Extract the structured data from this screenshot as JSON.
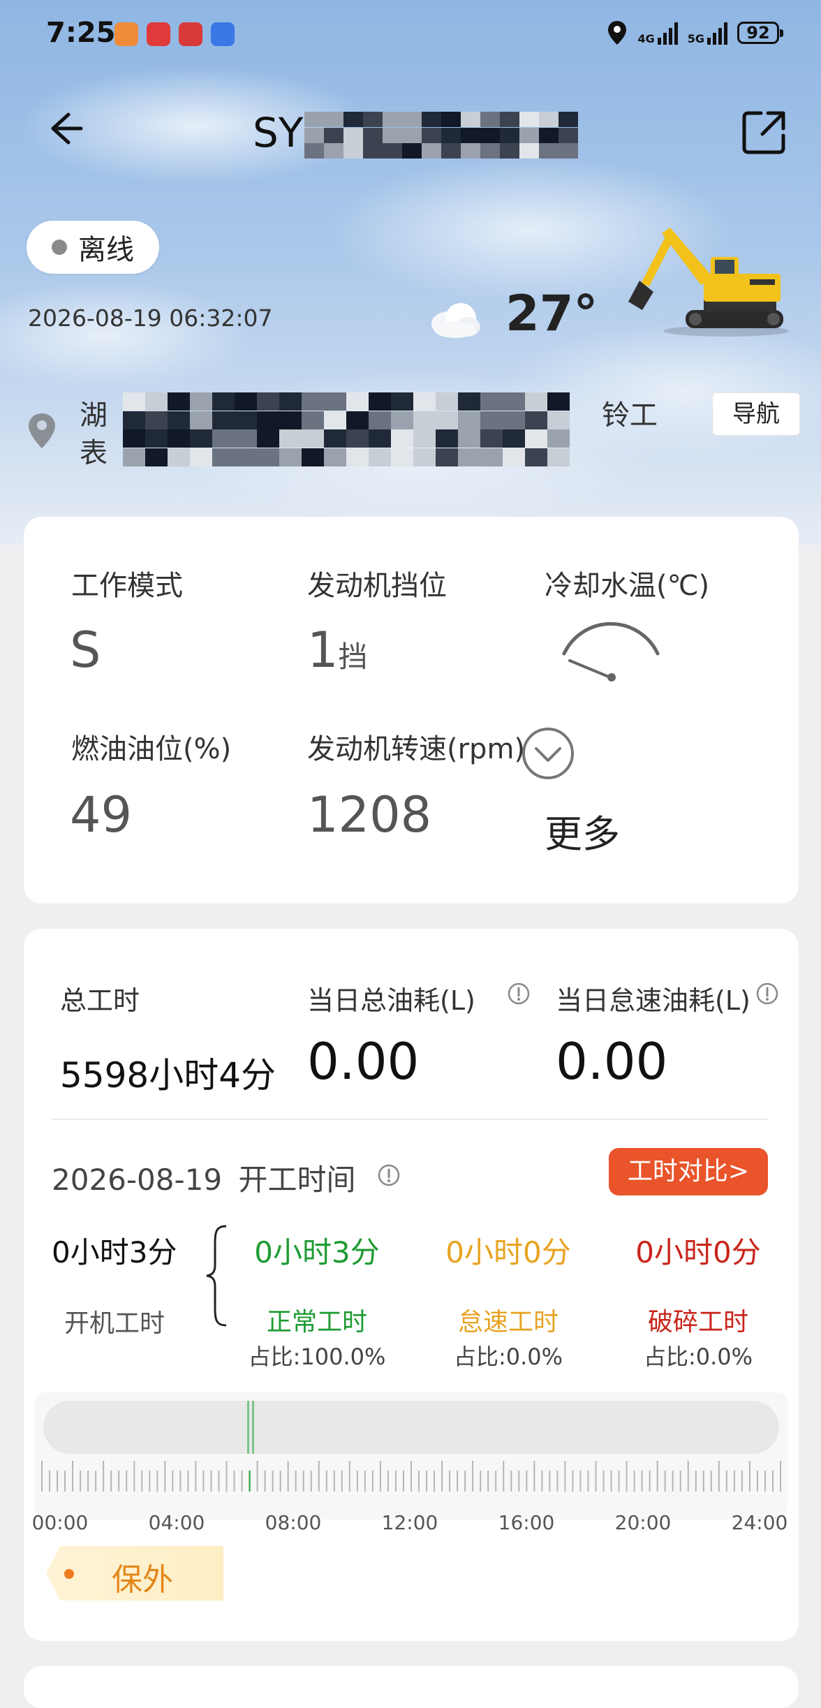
{
  "status_bar": {
    "time": "7:25",
    "network_4g": "4G",
    "network_5g": "5G",
    "battery": "92",
    "app_icon_colors": [
      "#f08b3a",
      "#e03a3a",
      "#d83a3a",
      "#3a78e8"
    ]
  },
  "header": {
    "title_prefix": "SY",
    "back_icon": "arrow-left-icon",
    "share_icon": "share-external-icon"
  },
  "device": {
    "status": "离线",
    "timestamp": "2026-08-19 06:32:07",
    "temperature": "27°",
    "weather_icon": "cloud-icon"
  },
  "location": {
    "line1_start": "湖",
    "line1_end": "铃工",
    "line2_start": "表",
    "nav_label": "导航"
  },
  "status_card": {
    "work_mode_label": "工作模式",
    "work_mode_value": "S",
    "gear_label": "发动机挡位",
    "gear_value": "1",
    "gear_unit": "挡",
    "coolant_label": "冷却水温(℃)",
    "fuel_label": "燃油油位(%)",
    "fuel_value": "49",
    "rpm_label": "发动机转速(rpm)",
    "rpm_value": "1208",
    "more_label": "更多"
  },
  "work_card": {
    "total_hours_label": "总工时",
    "total_hours_value": "5598小时4分",
    "daily_fuel_label": "当日总油耗(L)",
    "daily_fuel_value": "0.00",
    "idle_fuel_label": "当日怠速油耗(L)",
    "idle_fuel_value": "0.00",
    "date": "2026-08-19",
    "start_time_label": "开工时间",
    "compare_button": "工时对比>",
    "machine_hours_value": "0小时3分",
    "machine_hours_label": "开机工时",
    "breakdown": [
      {
        "value": "0小时3分",
        "label": "正常工时",
        "ratio": "占比:100.0%",
        "color": "#1e9b32"
      },
      {
        "value": "0小时0分",
        "label": "怠速工时",
        "ratio": "占比:0.0%",
        "color": "#e8a321"
      },
      {
        "value": "0小时0分",
        "label": "破碎工时",
        "ratio": "占比:0.0%",
        "color": "#c9241a"
      }
    ],
    "timeline": {
      "labels": [
        "00:00",
        "04:00",
        "08:00",
        "12:00",
        "16:00",
        "20:00",
        "24:00"
      ],
      "active_start_hour": 6.65
    },
    "warranty_label": "保外"
  }
}
